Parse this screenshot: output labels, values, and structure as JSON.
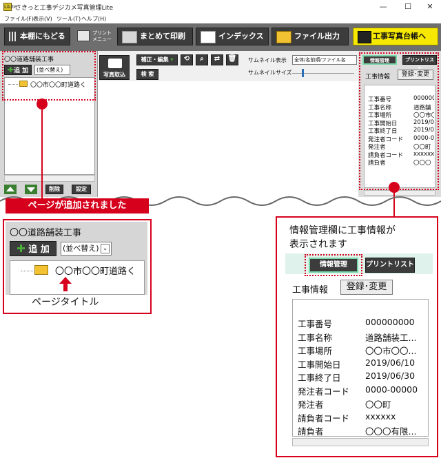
{
  "window": {
    "title": "さきっと工事デジカメ写真管理Lite",
    "app_icon": "LiLite",
    "controls": [
      "—",
      "☐",
      "✕"
    ]
  },
  "menu": [
    "ファイル(F)",
    "表示(V)",
    "ツール(T)",
    "ヘルプ(H)"
  ],
  "toolbar": {
    "back_label": "本棚にもどる",
    "print_menu_label": "プリント\nメニュー",
    "bulk_print_label": "まとめて印刷",
    "index_label": "インデックス",
    "file_output_label": "ファイル出力",
    "ledger_label": "工事写真台帳へ"
  },
  "left_panel": {
    "project_name": "〇〇道路舗装工事",
    "add_label": "追 加",
    "sort_label": "(並べ替え)",
    "page_item": "〇〇市〇〇町道路く",
    "delete_label": "削除",
    "settings_label": "設定"
  },
  "center_bar": {
    "import_label": "写真取込",
    "edit_label": "補正・編集",
    "search_label": "検 索",
    "thumb_display_label": "サムネイル表示",
    "thumb_display_value": "全体/名前順/ファイル名",
    "thumb_size_label": "サムネイルサイズ"
  },
  "right_panel": {
    "tab_info": "情報管理",
    "tab_print": "プリントリスト",
    "section_label": "工事情報",
    "register_label": "登録･変更",
    "fields": [
      {
        "k": "工事番号",
        "v": "000000"
      },
      {
        "k": "工事名称",
        "v": "道路舗"
      },
      {
        "k": "工事場所",
        "v": "〇〇市〇"
      },
      {
        "k": "工事開始日",
        "v": "2019/0"
      },
      {
        "k": "工事終了日",
        "v": "2019/0"
      },
      {
        "k": "発注者コード",
        "v": "0000-0"
      },
      {
        "k": "発注者",
        "v": "〇〇町"
      },
      {
        "k": "請負者コード",
        "v": "xxxxxx"
      },
      {
        "k": "請負者",
        "v": "〇〇〇"
      }
    ]
  },
  "callout_left": {
    "banner": "ページが追加されました",
    "project_name": "〇〇道路舗装工事",
    "add_label": "追 加",
    "sort_label": "(並べ替え)",
    "page_item": "〇〇市〇〇町道路く",
    "caption": "ページタイトル"
  },
  "callout_right": {
    "heading_line1": "情報管理欄に工事情報が",
    "heading_line2": "表示されます",
    "tab_info": "情報管理",
    "tab_print": "プリントリスト",
    "section_label": "工事情報",
    "register_label": "登録･変更",
    "fields": [
      {
        "k": "工事番号",
        "v": "000000000"
      },
      {
        "k": "工事名称",
        "v": "道路舗装工..."
      },
      {
        "k": "工事場所",
        "v": "〇〇市〇〇..."
      },
      {
        "k": "工事開始日",
        "v": "2019/06/10"
      },
      {
        "k": "工事終了日",
        "v": "2019/06/30"
      },
      {
        "k": "発注者コード",
        "v": "0000-00000"
      },
      {
        "k": "発注者",
        "v": "〇〇町"
      },
      {
        "k": "請負者コード",
        "v": "xxxxxx"
      },
      {
        "k": "請負者",
        "v": "〇〇〇有限..."
      }
    ]
  },
  "colors": {
    "accent_red": "#d6001c",
    "toolbar_gray": "#6e6e6e",
    "button_dark": "#3c3c3c",
    "yellow": "#f6e800"
  }
}
